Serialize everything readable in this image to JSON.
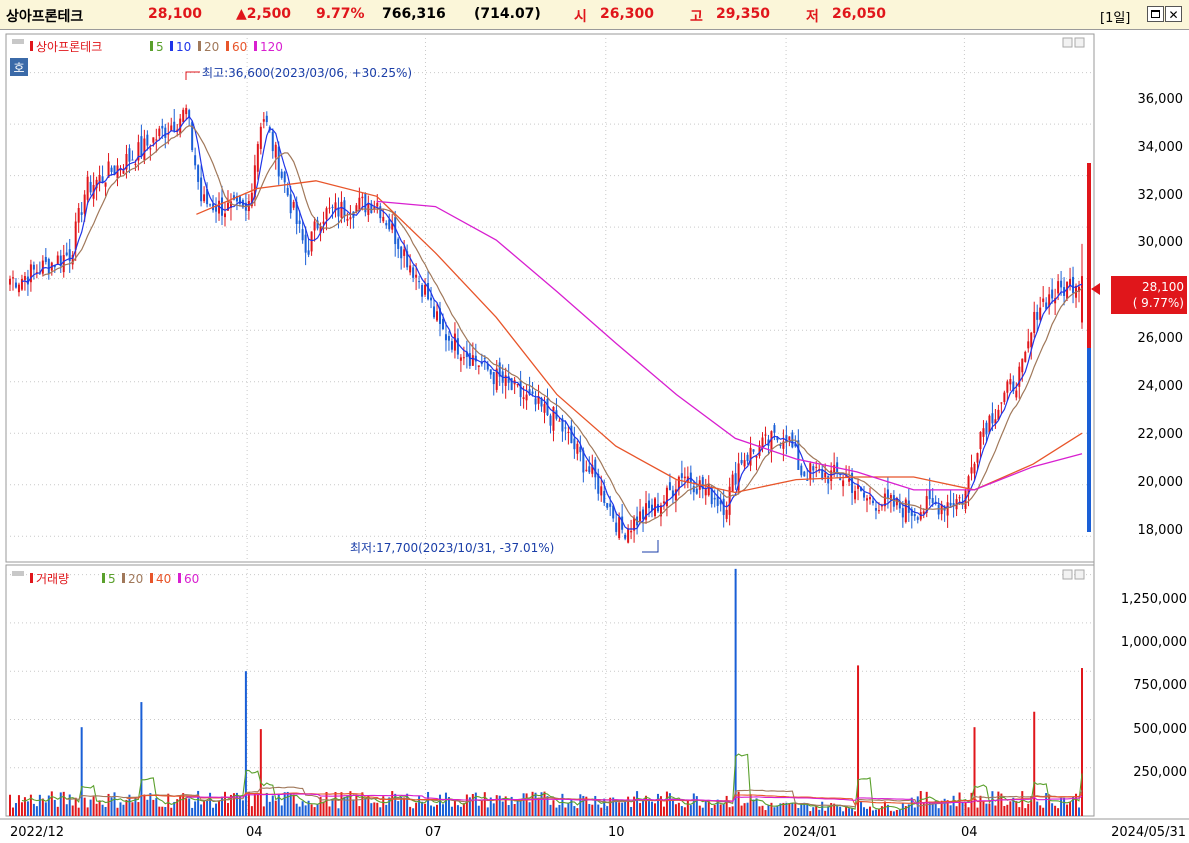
{
  "header": {
    "name": "상아프론테크",
    "price": "28,100",
    "change": "▲2,500",
    "change_pct": "9.77%",
    "volume": "766,316",
    "volume_ratio": "(714.07)",
    "open_label": "시",
    "open": "26,300",
    "high_label": "고",
    "high": "29,350",
    "low_label": "저",
    "low": "26,050",
    "period_label": "[1일]",
    "colors": {
      "up": "#e0161b",
      "down": "#1a5fd6",
      "text": "#000000"
    }
  },
  "price_panel": {
    "legend_name": "상아프론테크",
    "ma_labels": [
      "5",
      "10",
      "20",
      "60",
      "120"
    ],
    "ma_colors": [
      "#5aa02c",
      "#1f35e8",
      "#a0785a",
      "#e8552a",
      "#d81fd0"
    ],
    "badge": "호",
    "high_annotation": "최고:36,600(2023/03/06, +30.25%)",
    "low_annotation": "최저:17,700(2023/10/31, -37.01%)",
    "current_tag_price": "28,100",
    "current_tag_pct": "( 9.77%)",
    "y_ticks": [
      "36,000",
      "34,000",
      "32,000",
      "30,000",
      "26,000",
      "24,000",
      "22,000",
      "20,000",
      "18,000"
    ]
  },
  "volume_panel": {
    "legend_name": "거래량",
    "ma_labels": [
      "5",
      "20",
      "40",
      "60"
    ],
    "ma_colors": [
      "#5aa02c",
      "#a0785a",
      "#e8552a",
      "#d81fd0"
    ],
    "y_ticks": [
      "1,250,000",
      "1,000,000",
      "750,000",
      "500,000",
      "250,000"
    ]
  },
  "x_axis": {
    "labels": [
      "2022/12",
      "04",
      "07",
      "10",
      "2024/01",
      "04",
      "2024/05/31"
    ]
  },
  "chart_data": {
    "type": "candlestick",
    "title": "상아프론테크",
    "x_range": [
      "2022/12",
      "2024/05/31"
    ],
    "price_ylim": [
      17000,
      37500
    ],
    "volume_ylim": [
      0,
      1300000
    ],
    "highest": {
      "price": 36600,
      "date": "2023/03/06",
      "pct": "+30.25%"
    },
    "lowest": {
      "price": 17700,
      "date": "2023/10/31",
      "pct": "-37.01%"
    },
    "last": {
      "close": 28100,
      "change": 2500,
      "change_pct": 9.77,
      "open": 26300,
      "high": 29350,
      "low": 26050,
      "volume": 766316
    },
    "close_path": [
      [
        "2022/12",
        28000
      ],
      [
        "2023/01",
        29000
      ],
      [
        "2023/01",
        31500
      ],
      [
        "2023/02",
        33000
      ],
      [
        "2023/03",
        34500
      ],
      [
        "2023/03",
        31000
      ],
      [
        "2023/04",
        30500
      ],
      [
        "2023/04",
        34500
      ],
      [
        "2023/05",
        29000
      ],
      [
        "2023/05",
        30500
      ],
      [
        "2023/06",
        31000
      ],
      [
        "2023/07",
        27500
      ],
      [
        "2023/07",
        26000
      ],
      [
        "2023/08",
        24500
      ],
      [
        "2023/08",
        24000
      ],
      [
        "2023/09",
        22500
      ],
      [
        "2023/10",
        19500
      ],
      [
        "2023/10",
        18200
      ],
      [
        "2023/11",
        19500
      ],
      [
        "2023/11",
        20500
      ],
      [
        "2023/12",
        19200
      ],
      [
        "2023/12",
        21000
      ],
      [
        "2024/01",
        22000
      ],
      [
        "2024/01",
        20500
      ],
      [
        "2024/02",
        20300
      ],
      [
        "2024/02",
        19500
      ],
      [
        "2024/03",
        19000
      ],
      [
        "2024/04",
        19500
      ],
      [
        "2024/04",
        22000
      ],
      [
        "2024/05",
        24500
      ],
      [
        "2024/05",
        27000
      ],
      [
        "2024/05/31",
        28100
      ]
    ],
    "ma120_path": [
      [
        "2023/06",
        31000
      ],
      [
        "2023/07",
        30800
      ],
      [
        "2023/08",
        29500
      ],
      [
        "2023/09",
        27500
      ],
      [
        "2023/10",
        25500
      ],
      [
        "2023/11",
        23500
      ],
      [
        "2023/12",
        21800
      ],
      [
        "2024/01",
        21000
      ],
      [
        "2024/02",
        20500
      ],
      [
        "2024/03",
        19800
      ],
      [
        "2024/04",
        19800
      ],
      [
        "2024/05",
        20700
      ],
      [
        "2024/05/31",
        21200
      ]
    ],
    "ma60_path": [
      [
        "2023/03",
        30500
      ],
      [
        "2023/04",
        31500
      ],
      [
        "2023/05",
        31800
      ],
      [
        "2023/06",
        31200
      ],
      [
        "2023/07",
        29000
      ],
      [
        "2023/08",
        26500
      ],
      [
        "2023/09",
        23500
      ],
      [
        "2023/10",
        21500
      ],
      [
        "2023/11",
        20200
      ],
      [
        "2023/12",
        19700
      ],
      [
        "2024/01",
        20200
      ],
      [
        "2024/02",
        20300
      ],
      [
        "2024/03",
        20300
      ],
      [
        "2024/04",
        19800
      ],
      [
        "2024/05",
        20800
      ],
      [
        "2024/05/31",
        22000
      ]
    ],
    "volume_spikes": [
      {
        "date": "2023/01",
        "volume": 460000
      },
      {
        "date": "2023/02",
        "volume": 590000
      },
      {
        "date": "2023/04",
        "volume": 750000
      },
      {
        "date": "2023/04",
        "volume": 450000
      },
      {
        "date": "2023/12",
        "volume": 1280000
      },
      {
        "date": "2024/02",
        "volume": 780000
      },
      {
        "date": "2024/04",
        "volume": 460000
      },
      {
        "date": "2024/05",
        "volume": 540000
      },
      {
        "date": "2024/05/31",
        "volume": 766316
      }
    ]
  }
}
